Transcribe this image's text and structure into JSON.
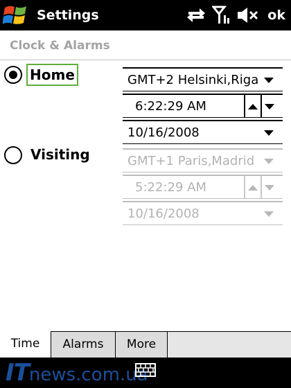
{
  "titlebar": {
    "title": "Settings",
    "ok_label": "ok",
    "icons": [
      "windows-logo",
      "data-sync-icon",
      "signal-strength-icon",
      "speaker-mute-icon"
    ]
  },
  "page": {
    "title": "Clock & Alarms"
  },
  "home": {
    "label": "Home",
    "selected": true,
    "timezone": "GMT+2 Helsinki,Riga",
    "time": "6:22:29 AM",
    "date": "10/16/2008"
  },
  "visiting": {
    "label": "Visiting",
    "selected": false,
    "timezone": "GMT+1 Paris,Madrid",
    "time": "5:22:29 AM",
    "date": "10/16/2008"
  },
  "tabs": [
    {
      "label": "Time",
      "active": true
    },
    {
      "label": "Alarms",
      "active": false
    },
    {
      "label": "More",
      "active": false
    }
  ],
  "watermark": {
    "prefix": "IT",
    "rest": "news.com.ua"
  },
  "colors": {
    "focus_border": "#5fae3b",
    "disabled_text": "#b3b3b3",
    "watermark": "#1a4f9c"
  }
}
